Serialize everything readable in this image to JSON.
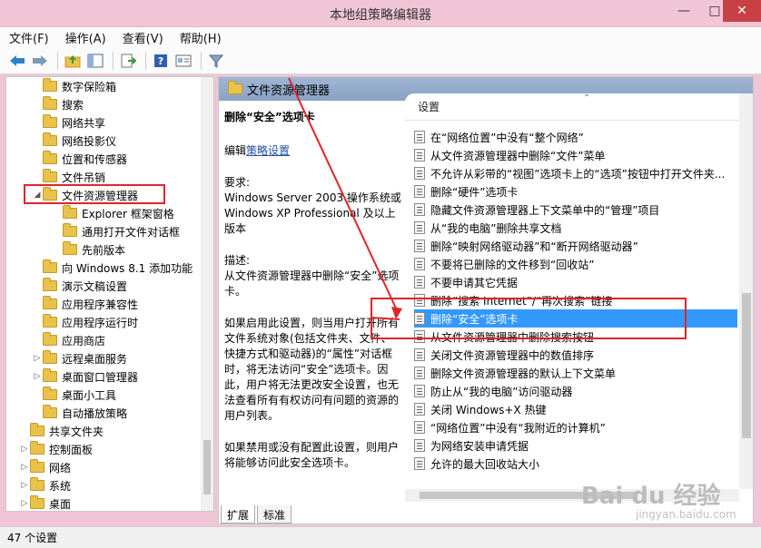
{
  "window": {
    "title": "本地组策略编辑器"
  },
  "menu": [
    "文件(F)",
    "操作(A)",
    "查看(V)",
    "帮助(H)"
  ],
  "toolbar_icons": [
    "back-icon",
    "forward-icon",
    "up-folder-icon",
    "show-hide-tree-icon",
    "export-list-icon",
    "help-icon",
    "properties-icon",
    "filter-icon"
  ],
  "tree": [
    {
      "label": "数字保险箱",
      "level": 2
    },
    {
      "label": "搜索",
      "level": 2
    },
    {
      "label": "网络共享",
      "level": 2
    },
    {
      "label": "网络投影仪",
      "level": 2
    },
    {
      "label": "位置和传感器",
      "level": 2
    },
    {
      "label": "文件吊销",
      "level": 2
    },
    {
      "label": "文件资源管理器",
      "level": 2,
      "expanded": true
    },
    {
      "label": "Explorer 框架窗格",
      "level": 3
    },
    {
      "label": "通用打开文件对话框",
      "level": 3
    },
    {
      "label": "先前版本",
      "level": 3
    },
    {
      "label": "向 Windows 8.1 添加功能",
      "level": 2
    },
    {
      "label": "演示文稿设置",
      "level": 2
    },
    {
      "label": "应用程序兼容性",
      "level": 2
    },
    {
      "label": "应用程序运行时",
      "level": 2
    },
    {
      "label": "应用商店",
      "level": 2
    },
    {
      "label": "远程桌面服务",
      "level": 2,
      "collapsed": true
    },
    {
      "label": "桌面窗口管理器",
      "level": 2,
      "collapsed": true
    },
    {
      "label": "桌面小工具",
      "level": 2
    },
    {
      "label": "自动播放策略",
      "level": 2
    },
    {
      "label": "共享文件夹",
      "level": 1
    },
    {
      "label": "控制面板",
      "level": 1,
      "collapsed": true
    },
    {
      "label": "网络",
      "level": 1,
      "collapsed": true
    },
    {
      "label": "系统",
      "level": 1,
      "collapsed": true
    },
    {
      "label": "桌面",
      "level": 1,
      "collapsed": true
    }
  ],
  "right_header": "文件资源管理器",
  "description": {
    "heading": "删除“安全”选项卡",
    "edit_prefix": "编辑",
    "edit_link": "策略设置",
    "requirement": "要求:\nWindows Server 2003 操作系统或 Windows XP Professional 及以上版本",
    "describe": "描述:\n从文件资源管理器中删除“安全”选项卡。",
    "enabled": "如果启用此设置，则当用户打开所有文件系统对象(包括文件夹、文件、快捷方式和驱动器)的“属性”对话框时，将无法访问“安全”选项卡。因此，用户将无法更改安全设置，也无法查看所有有权访问有问题的资源的用户列表。",
    "disabled": "如果禁用或没有配置此设置，则用户将能够访问此安全选项卡。"
  },
  "list": {
    "column": "设置",
    "rows": [
      "在“网络位置”中没有“整个网络”",
      "从文件资源管理器中删除“文件”菜单",
      "不允许从彩带的“视图”选项卡上的“选项”按钮中打开文件夹...",
      "删除“硬件”选项卡",
      "隐藏文件资源管理器上下文菜单中的“管理”项目",
      "从“我的电脑”删除共享文档",
      "删除“映射网络驱动器”和“断开网络驱动器”",
      "不要将已删除的文件移到“回收站”",
      "不要申请其它凭据",
      "删除“搜索 Internet”/“再次搜索”链接",
      "删除“安全”选项卡",
      "从文件资源管理器中删除搜索按钮",
      "关闭文件资源管理器中的数值排序",
      "删除文件资源管理器的默认上下文菜单",
      "防止从“我的电脑”访问驱动器",
      "关闭 Windows+X 热键",
      "“网络位置”中没有“我附近的计算机”",
      "为网络安装申请凭据",
      "允许的最大回收站大小"
    ],
    "selected_index": 10
  },
  "tabs": [
    "扩展",
    "标准"
  ],
  "status": "47 个设置",
  "watermark": {
    "brand": "Bai du 经验",
    "url": "jingyan.baidu.com"
  }
}
